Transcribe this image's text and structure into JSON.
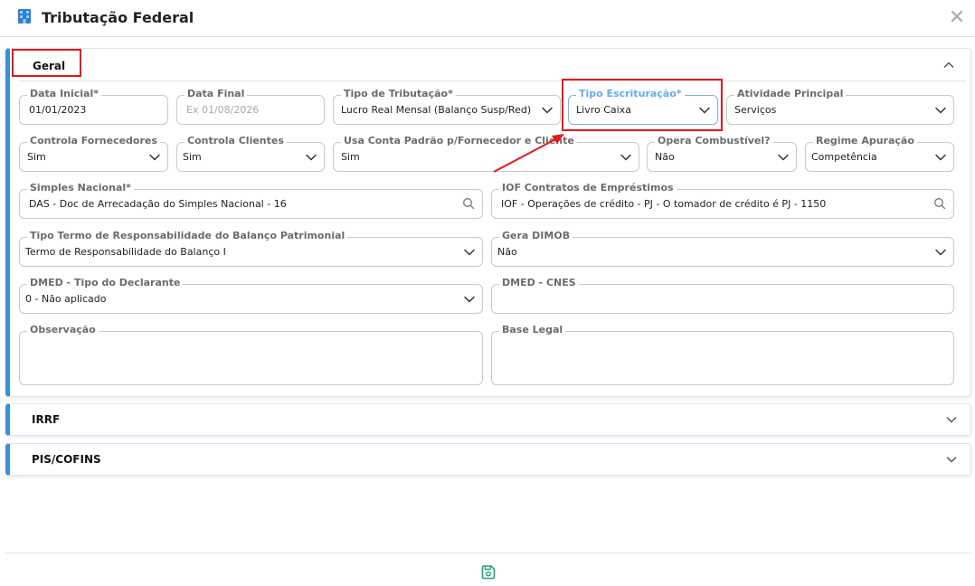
{
  "window": {
    "title": "Tributação Federal"
  },
  "sections": {
    "geral": {
      "title": "Geral"
    },
    "irrf": {
      "title": "IRRF"
    },
    "pis": {
      "title": "PIS/COFINS"
    }
  },
  "fields": {
    "data_inicial": {
      "label": "Data Inicial*",
      "value": "01/01/2023"
    },
    "data_final": {
      "label": "Data Final",
      "placeholder": "Ex 01/08/2026"
    },
    "tipo_tributacao": {
      "label": "Tipo de Tributação*",
      "value": "Lucro Real Mensal (Balanço Susp/Red)"
    },
    "tipo_escrituracao": {
      "label": "Tipo Escrituração*",
      "value": "Livro Caixa"
    },
    "atividade_principal": {
      "label": "Atividade Principal",
      "value": "Serviços"
    },
    "controla_fornecedores": {
      "label": "Controla Fornecedores",
      "value": "Sim"
    },
    "controla_clientes": {
      "label": "Controla Clientes",
      "value": "Sim"
    },
    "usa_conta_padrao": {
      "label": "Usa Conta Padrão p/Fornecedor e Cliente",
      "value": "Sim"
    },
    "opera_combustivel": {
      "label": "Opera Combustível?",
      "value": "Não"
    },
    "regime_apuracao": {
      "label": "Regime Apuração",
      "value": "Competência"
    },
    "simples_nacional": {
      "label": "Simples Nacional*",
      "value": "DAS - Doc de Arrecadação do Simples Nacional - 16"
    },
    "iof_contratos": {
      "label": "IOF Contratos de Empréstimos",
      "value": "IOF - Operações de crédito - PJ - O tomador de crédito é PJ - 1150"
    },
    "tipo_termo": {
      "label": "Tipo Termo de Responsabilidade do Balanço Patrimonial",
      "value": "Termo de Responsabilidade do Balanço I"
    },
    "gera_dimob": {
      "label": "Gera DIMOB",
      "value": "Não"
    },
    "dmed_tipo": {
      "label": "DMED - Tipo do Declarante",
      "value": "0 - Não aplicado"
    },
    "dmed_cnes": {
      "label": "DMED - CNES",
      "value": ""
    },
    "observacao": {
      "label": "Observação",
      "value": ""
    },
    "base_legal": {
      "label": "Base Legal",
      "value": ""
    }
  },
  "colors": {
    "accent": "#3d8fd6",
    "highlight": "#e1191b",
    "save_icon": "#1fa37a"
  },
  "icons": [
    "building-icon",
    "close-icon",
    "chevron-up-icon",
    "chevron-down-icon",
    "search-icon",
    "save-icon"
  ]
}
